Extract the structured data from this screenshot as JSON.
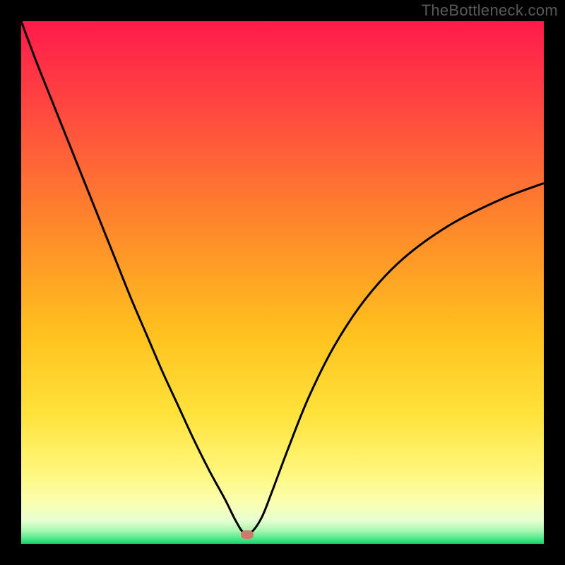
{
  "watermark": "TheBottleneck.com",
  "chart_data": {
    "type": "line",
    "title": "",
    "xlabel": "",
    "ylabel": "",
    "xlim": [
      0,
      100
    ],
    "ylim": [
      0,
      100
    ],
    "grid": false,
    "legend": false,
    "gradient_stops": [
      {
        "offset": 0,
        "color": "#ff1a4b"
      },
      {
        "offset": 0.18,
        "color": "#ff4b3f"
      },
      {
        "offset": 0.4,
        "color": "#ff8a2a"
      },
      {
        "offset": 0.6,
        "color": "#ffc21e"
      },
      {
        "offset": 0.75,
        "color": "#ffe23a"
      },
      {
        "offset": 0.86,
        "color": "#fff67a"
      },
      {
        "offset": 0.92,
        "color": "#fbffb0"
      },
      {
        "offset": 0.955,
        "color": "#e8ffd0"
      },
      {
        "offset": 0.975,
        "color": "#a8f7b0"
      },
      {
        "offset": 0.99,
        "color": "#4de88a"
      },
      {
        "offset": 1.0,
        "color": "#18d46a"
      }
    ],
    "series": [
      {
        "name": "bottleneck-curve",
        "color": "#000000",
        "width": 3,
        "x": [
          0,
          3,
          6,
          9,
          12,
          15,
          18,
          21,
          24,
          27,
          30,
          33,
          36,
          39,
          41,
          42.5,
          44,
          46,
          48,
          51,
          55,
          60,
          66,
          73,
          82,
          92,
          100
        ],
        "y": [
          100,
          92,
          84.5,
          77,
          69.5,
          62,
          54.5,
          47,
          40,
          33,
          26.5,
          20,
          14,
          8.5,
          4.5,
          2.2,
          2.2,
          5,
          10,
          18,
          28,
          38,
          47,
          54.5,
          61,
          66,
          69
        ]
      }
    ],
    "marker": {
      "x": 43.2,
      "y": 1.7,
      "color": "#cd7a6e"
    }
  }
}
